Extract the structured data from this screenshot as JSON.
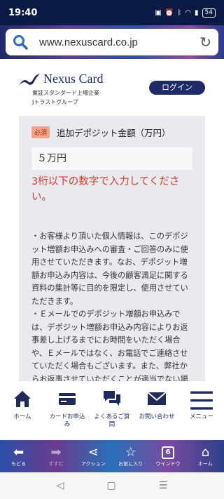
{
  "status_bar": {
    "time": "19:40",
    "icons": [
      "nfc-icon",
      "alarm-icon",
      "bluetooth-icon",
      "wifi-icon",
      "signal-icon"
    ],
    "battery": "54"
  },
  "browser": {
    "url": "www.nexuscard.co.jp"
  },
  "header": {
    "logo_name": "Nexus Card",
    "logo_sub1": "東証スタンダード上場企業",
    "logo_sub2": "Jトラストグループ",
    "login_label": "ログイン"
  },
  "form": {
    "required_badge": "必須",
    "field_label": "追加デポジット金額（万円）",
    "amount_value": "５万円",
    "error_message": "3桁以下の数字で入力してください。",
    "notes": [
      "・お客様より頂いた個人情報は、このデポジット増額お申込みへの審査・ご回答のみに使用させていただきます。なお、デポジット増額お申込み内容は、今後の顧客満足に関する資料の集計等に目的を限定し、使用させていただきます。",
      "・Ｅメールでのデポジット増額お申込みでは、デポジット増額お申込み内容によりお返事差し上げるまでにお時間をいただく場合や、Ｅメールではなく、お電話でご連絡させていただく場合もございます。また、弊社からお返事させていただくことが適当でない場合には、お返事を"
    ]
  },
  "site_nav": [
    {
      "label": "ホーム",
      "icon": "home-icon"
    },
    {
      "label": "カードお申込み",
      "icon": "credit-card-icon"
    },
    {
      "label": "よくあるご質問",
      "icon": "chat-icon"
    },
    {
      "label": "お問い合わせ",
      "icon": "mail-icon"
    },
    {
      "label": "メニュー",
      "icon": "menu-icon"
    }
  ],
  "browser_toolbar": [
    {
      "label": "もどる",
      "icon": "back-arrow-icon"
    },
    {
      "label": "すすむ",
      "icon": "forward-arrow-icon"
    },
    {
      "label": "アクション",
      "icon": "share-icon"
    },
    {
      "label": "お気に入り",
      "icon": "star-icon"
    },
    {
      "label": "ウインドウ",
      "icon": "tabs-icon",
      "count": "6"
    },
    {
      "label": "ホーム",
      "icon": "browser-home-icon"
    }
  ],
  "colors": {
    "navy": "#1f2a5a",
    "error": "#d33a2c",
    "badge": "#f3a58a"
  }
}
